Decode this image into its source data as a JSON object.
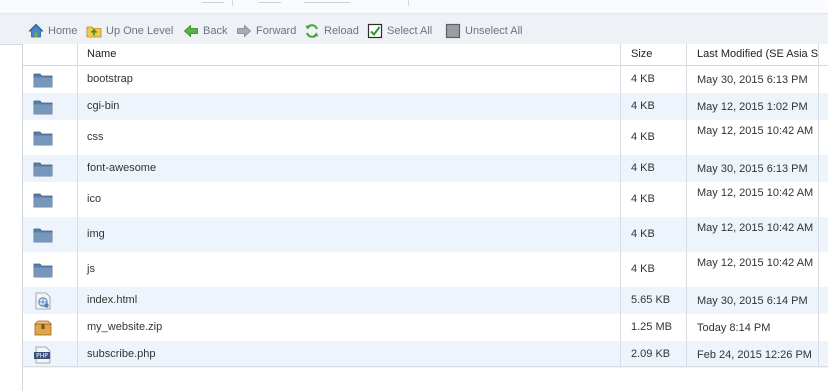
{
  "toolbar": {
    "home": "Home",
    "up": "Up One Level",
    "back": "Back",
    "forward": "Forward",
    "reload": "Reload",
    "select_all": "Select All",
    "unselect_all": "Unselect All"
  },
  "columns": {
    "name": "Name",
    "size": "Size",
    "modified": "Last Modified (SE Asia S"
  },
  "files": [
    {
      "name": "bootstrap",
      "type": "folder",
      "size": "4 KB",
      "date": "May 30, 2015 6:13 PM"
    },
    {
      "name": "cgi-bin",
      "type": "folder",
      "size": "4 KB",
      "date": "May 12, 2015 1:02 PM"
    },
    {
      "name": "css",
      "type": "folder",
      "size": "4 KB",
      "date": "May 12, 2015 10:42 AM"
    },
    {
      "name": "font-awesome",
      "type": "folder",
      "size": "4 KB",
      "date": "May 30, 2015 6:13 PM"
    },
    {
      "name": "ico",
      "type": "folder",
      "size": "4 KB",
      "date": "May 12, 2015 10:42 AM"
    },
    {
      "name": "img",
      "type": "folder",
      "size": "4 KB",
      "date": "May 12, 2015 10:42 AM"
    },
    {
      "name": "js",
      "type": "folder",
      "size": "4 KB",
      "date": "May 12, 2015 10:42 AM"
    },
    {
      "name": "index.html",
      "type": "html",
      "size": "5.65 KB",
      "date": "May 30, 2015 6:14 PM"
    },
    {
      "name": "my_website.zip",
      "type": "zip",
      "size": "1.25 MB",
      "date": "Today 8:14 PM"
    },
    {
      "name": "subscribe.php",
      "type": "php",
      "size": "2.09 KB",
      "date": "Feb 24, 2015 12:26 PM"
    }
  ],
  "colors": {
    "row_alt": "#eef4fb",
    "folder": "#5b7fa6",
    "toolbar_bg": "#eef2f6"
  }
}
